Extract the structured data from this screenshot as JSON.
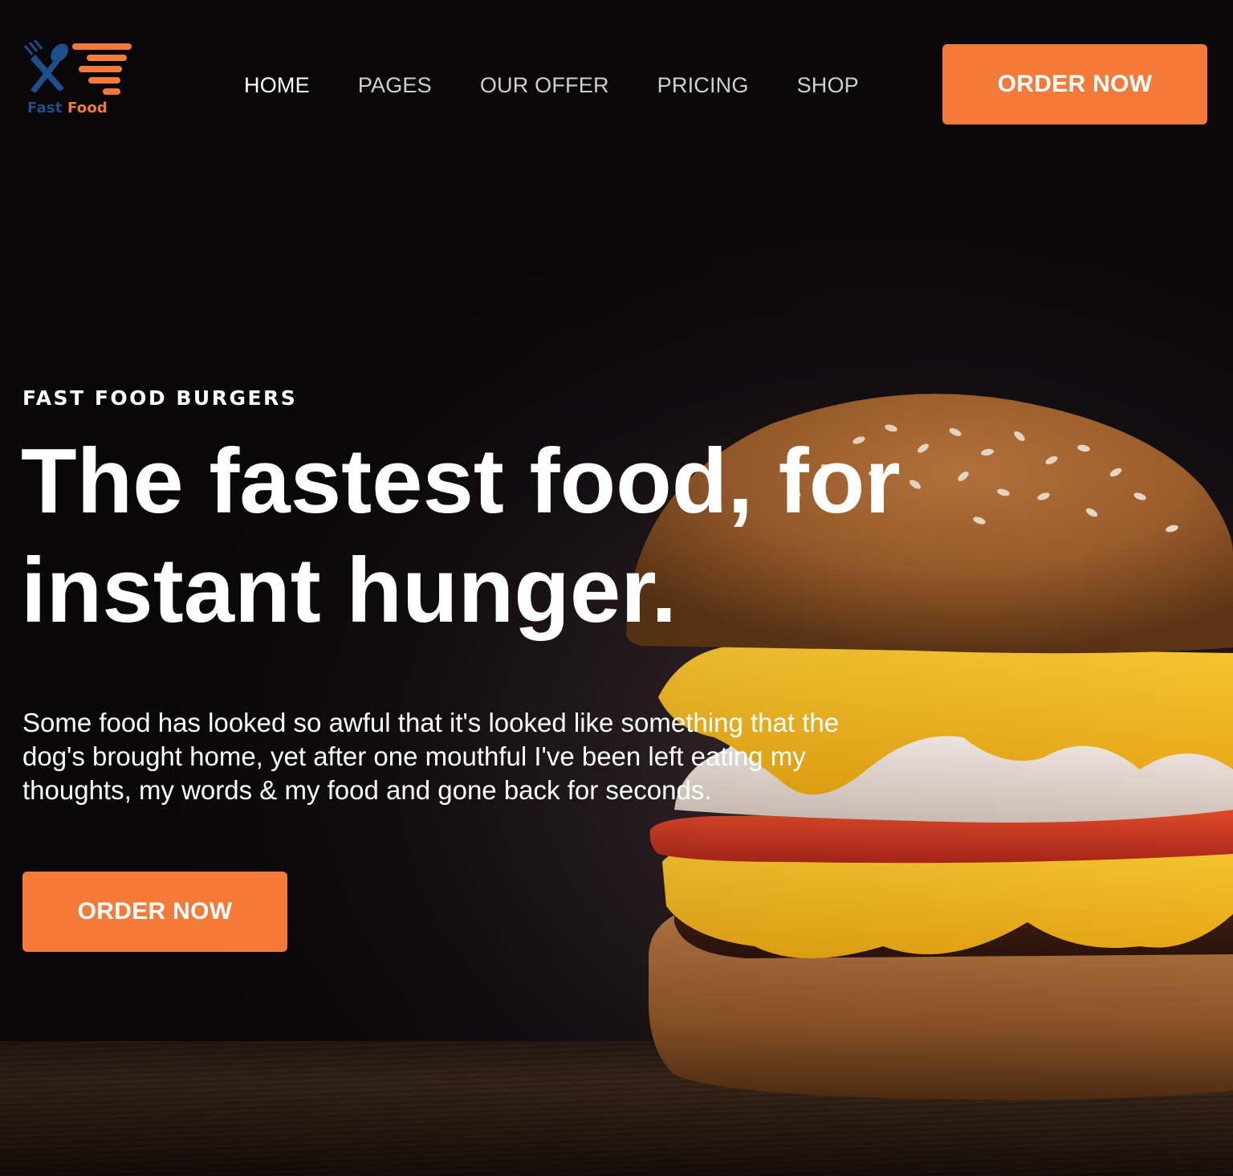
{
  "brand": {
    "logo_text_main": "Fast ",
    "logo_text_accent": "Food",
    "colors": {
      "accent": "#f37a39",
      "logo_blue": "#1f4e8f",
      "background": "#0d0a0b"
    }
  },
  "nav": {
    "items": [
      {
        "label": "HOME",
        "active": true
      },
      {
        "label": "PAGES",
        "active": false
      },
      {
        "label": "OUR OFFER",
        "active": false
      },
      {
        "label": "PRICING",
        "active": false
      },
      {
        "label": "SHOP",
        "active": false
      }
    ]
  },
  "header": {
    "cta_label": "ORDER NOW"
  },
  "hero": {
    "eyebrow": "FAST FOOD BURGERS",
    "headline_line1": "The fastest food, for",
    "headline_line2": "instant hunger.",
    "body": "Some food has looked so awful that it's looked like something that the dog's brought home, yet after one mouthful I've been left eating my thoughts, my words & my food and gone back for seconds.",
    "cta_label": "ORDER NOW",
    "image": "burger-photo"
  }
}
